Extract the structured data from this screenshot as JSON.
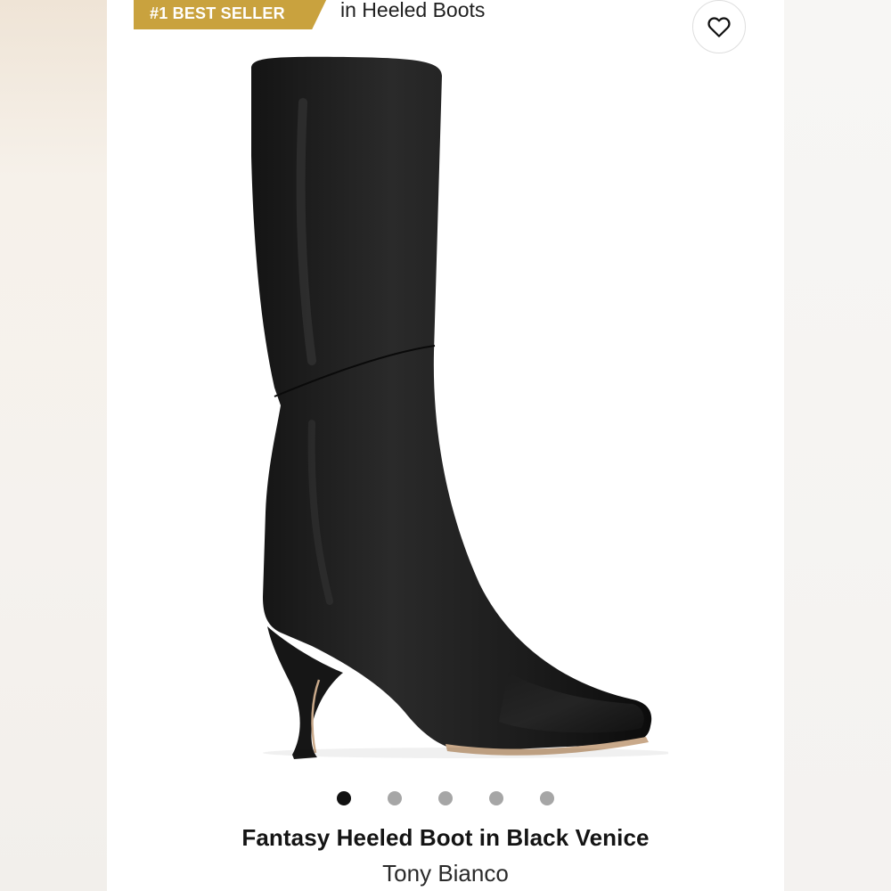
{
  "badge": {
    "label": "#1 BEST SELLER",
    "context": "in Heeled Boots",
    "color": "#c9a23e"
  },
  "wishlist": {
    "icon": "heart-outline-icon"
  },
  "gallery": {
    "image_subject": "Black leather knee-high heeled boot",
    "slide_count": 5,
    "active_index": 0
  },
  "product": {
    "title": "Fantasy Heeled Boot in Black Venice",
    "brand": "Tony Bianco"
  }
}
